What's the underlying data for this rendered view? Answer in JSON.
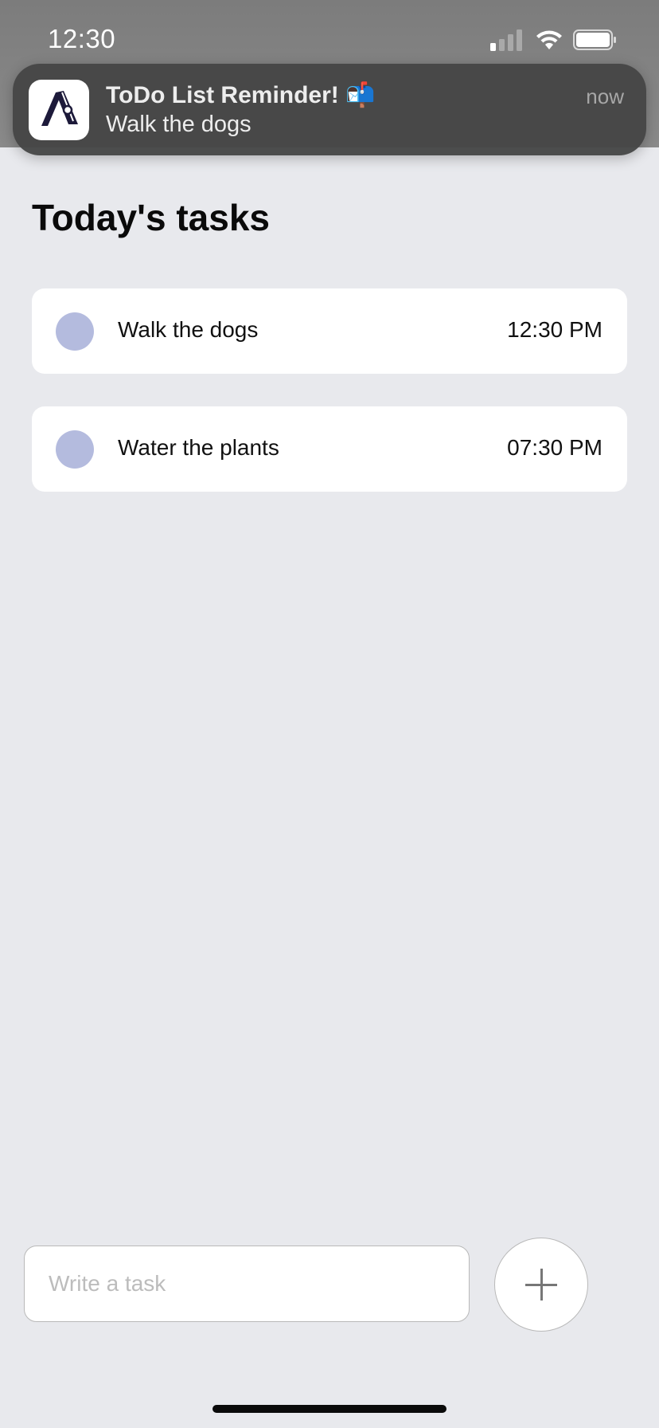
{
  "status_bar": {
    "time": "12:30"
  },
  "notification": {
    "app_icon": "todo-app-logo",
    "title": "ToDo List Reminder! 📬",
    "body": "Walk the dogs",
    "time": "now"
  },
  "page": {
    "title": "Today's tasks"
  },
  "tasks": [
    {
      "title": "Walk the dogs",
      "time": "12:30 PM",
      "completed": false
    },
    {
      "title": "Water the plants",
      "time": "07:30 PM",
      "completed": false
    }
  ],
  "composer": {
    "input_placeholder": "Write a task",
    "input_value": "",
    "add_button_icon": "plus-icon"
  },
  "colors": {
    "background": "#e8e9ed",
    "task_circle": "#b4bbde",
    "card": "#ffffff",
    "notification_bg": "#464646"
  }
}
